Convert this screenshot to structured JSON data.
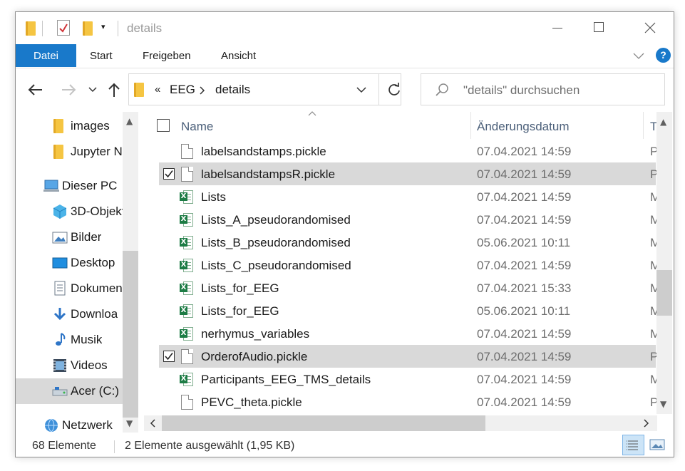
{
  "titlebar": {
    "title": "details"
  },
  "ribbon": {
    "tabs": [
      "Datei",
      "Start",
      "Freigeben",
      "Ansicht"
    ],
    "help": "?"
  },
  "addressbar": {
    "chevron": "«",
    "crumbs": [
      "EEG",
      "details"
    ],
    "search_placeholder": "\"details\" durchsuchen"
  },
  "nav": {
    "items": [
      {
        "label": "images",
        "icon": "folder-icon"
      },
      {
        "label": "Jupyter N",
        "icon": "folder-icon"
      },
      {
        "label": "Dieser PC",
        "icon": "computer-icon"
      },
      {
        "label": "3D-Objekt",
        "icon": "cube-icon"
      },
      {
        "label": "Bilder",
        "icon": "pictures-icon"
      },
      {
        "label": "Desktop",
        "icon": "desktop-icon"
      },
      {
        "label": "Dokumen",
        "icon": "document-icon"
      },
      {
        "label": "Downloa",
        "icon": "download-icon"
      },
      {
        "label": "Musik",
        "icon": "music-icon"
      },
      {
        "label": "Videos",
        "icon": "video-icon"
      },
      {
        "label": "Acer (C:)",
        "icon": "drive-icon"
      },
      {
        "label": "Netzwerk",
        "icon": "network-icon"
      }
    ]
  },
  "columns": {
    "name": "Name",
    "date": "Änderungsdatum",
    "type": "T"
  },
  "files": [
    {
      "name": "labelsandstamps.pickle",
      "date": "07.04.2021 14:59",
      "type": "P",
      "kind": "file",
      "selected": false
    },
    {
      "name": "labelsandstampsR.pickle",
      "date": "07.04.2021 14:59",
      "type": "P",
      "kind": "file",
      "selected": true
    },
    {
      "name": "Lists",
      "date": "07.04.2021 14:59",
      "type": "M",
      "kind": "excel",
      "selected": false
    },
    {
      "name": "Lists_A_pseudorandomised",
      "date": "07.04.2021 14:59",
      "type": "M",
      "kind": "excel",
      "selected": false
    },
    {
      "name": "Lists_B_pseudorandomised",
      "date": "05.06.2021 10:11",
      "type": "M",
      "kind": "excel",
      "selected": false
    },
    {
      "name": "Lists_C_pseudorandomised",
      "date": "07.04.2021 14:59",
      "type": "M",
      "kind": "excel",
      "selected": false
    },
    {
      "name": "Lists_for_EEG",
      "date": "07.04.2021 15:33",
      "type": "M",
      "kind": "excel",
      "selected": false
    },
    {
      "name": "Lists_for_EEG",
      "date": "05.06.2021 10:11",
      "type": "M",
      "kind": "excel",
      "selected": false
    },
    {
      "name": "nerhymus_variables",
      "date": "07.04.2021 14:59",
      "type": "M",
      "kind": "excel",
      "selected": false
    },
    {
      "name": "OrderofAudio.pickle",
      "date": "07.04.2021 14:59",
      "type": "P",
      "kind": "file",
      "selected": true
    },
    {
      "name": "Participants_EEG_TMS_details",
      "date": "07.04.2021 14:59",
      "type": "M",
      "kind": "excel",
      "selected": false
    },
    {
      "name": "PEVC_theta.pickle",
      "date": "07.04.2021 14:59",
      "type": "P",
      "kind": "file",
      "selected": false
    }
  ],
  "statusbar": {
    "count": "68 Elemente",
    "selection": "2 Elemente ausgewählt (1,95 KB)"
  },
  "colors": {
    "accent": "#1979ca",
    "selection": "#d9d9d9",
    "excel": "#1d7c45",
    "folder": "#f5c542"
  }
}
